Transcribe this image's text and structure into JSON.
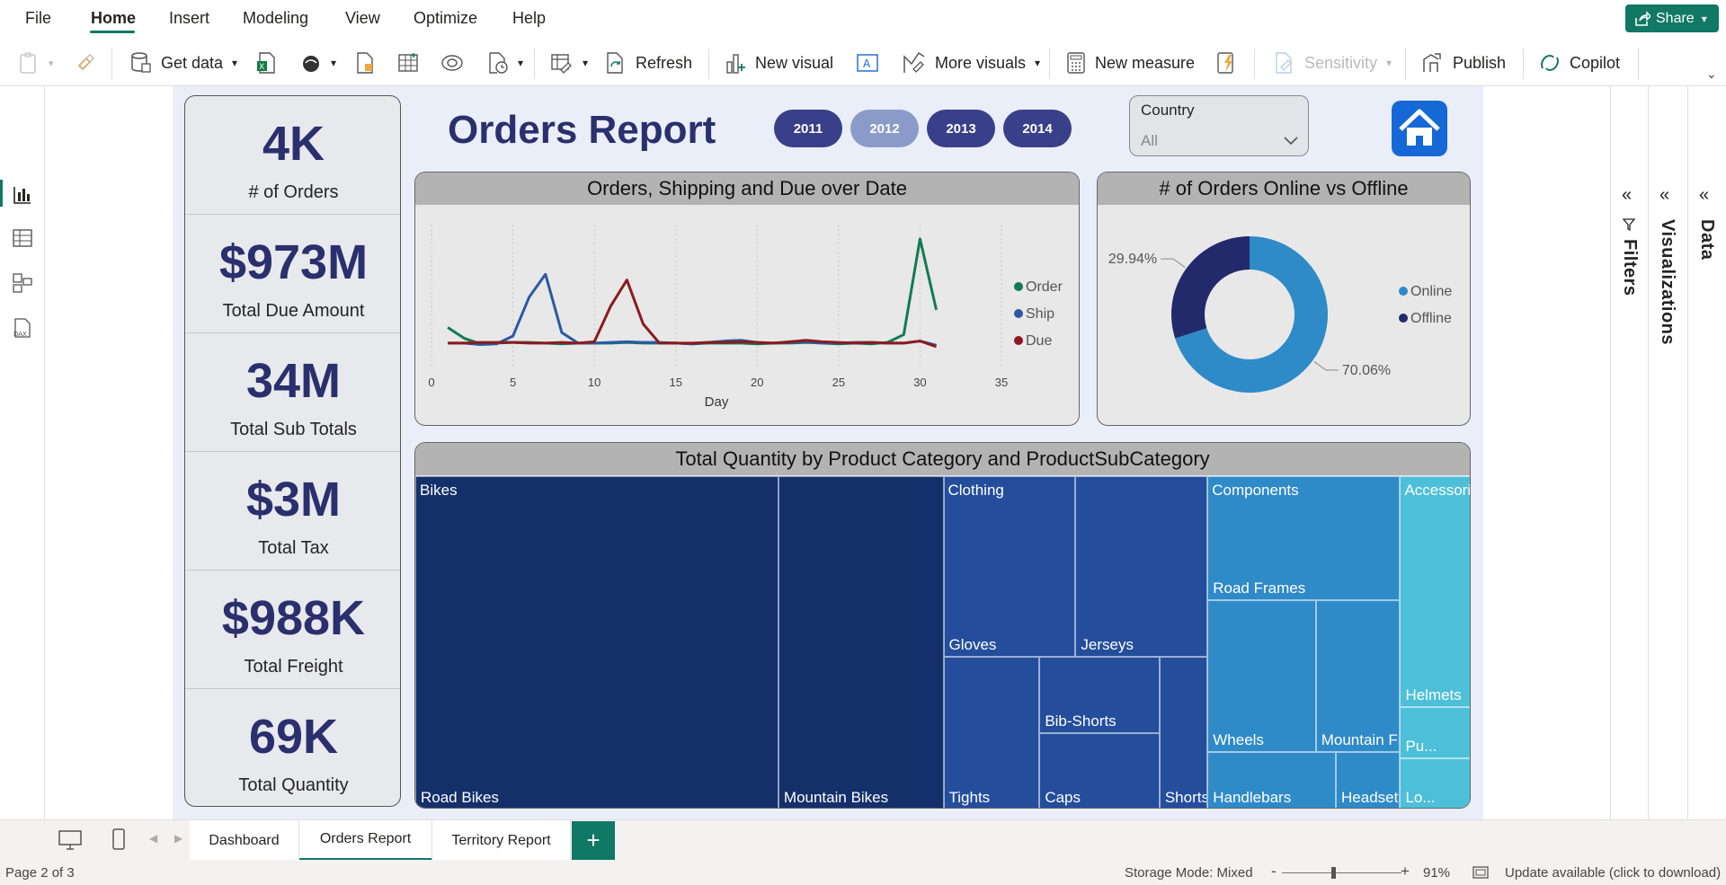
{
  "menu": {
    "items": [
      "File",
      "Home",
      "Insert",
      "Modeling",
      "View",
      "Optimize",
      "Help"
    ],
    "share": "Share"
  },
  "ribbon": {
    "get_data": "Get data",
    "refresh": "Refresh",
    "new_visual": "New visual",
    "more_visuals": "More visuals",
    "new_measure": "New measure",
    "sensitivity": "Sensitivity",
    "publish": "Publish",
    "copilot": "Copilot"
  },
  "panes": {
    "filters": "Filters",
    "visualizations": "Visualizations",
    "data": "Data"
  },
  "report": {
    "title": "Orders Report",
    "years": [
      "2011",
      "2012",
      "2013",
      "2014"
    ],
    "selected_year": "2012",
    "country": {
      "label": "Country",
      "value": "All"
    },
    "kpis": [
      {
        "value": "4K",
        "label": "# of Orders"
      },
      {
        "value": "$973M",
        "label": "Total Due Amount"
      },
      {
        "value": "34M",
        "label": "Total Sub Totals"
      },
      {
        "value": "$3M",
        "label": "Total Tax"
      },
      {
        "value": "$988K",
        "label": "Total Freight"
      },
      {
        "value": "69K",
        "label": "Total Quantity"
      }
    ]
  },
  "chart_data": [
    {
      "type": "line",
      "title": "Orders, Shipping and Due over Date",
      "xlabel": "Day",
      "xlim": [
        0,
        35
      ],
      "xticks": [
        0,
        5,
        10,
        15,
        20,
        25,
        30,
        35
      ],
      "grid": true,
      "legend": "right",
      "x": [
        1,
        2,
        3,
        4,
        5,
        6,
        7,
        8,
        9,
        10,
        11,
        12,
        13,
        14,
        15,
        16,
        17,
        18,
        19,
        20,
        21,
        22,
        23,
        24,
        25,
        26,
        27,
        28,
        29,
        30,
        31
      ],
      "series": [
        {
          "name": "Order",
          "color": "#137a55",
          "values": [
            55,
            40,
            32,
            33,
            34,
            34,
            33,
            32,
            33,
            33,
            33,
            34,
            33,
            33,
            33,
            32,
            33,
            33,
            33,
            32,
            33,
            33,
            34,
            33,
            32,
            33,
            32,
            34,
            45,
            180,
            80
          ]
        },
        {
          "name": "Ship",
          "color": "#2b59a3",
          "values": [
            33,
            33,
            31,
            32,
            43,
            98,
            130,
            48,
            33,
            33,
            34,
            35,
            34,
            34,
            33,
            32,
            34,
            36,
            37,
            34,
            33,
            34,
            35,
            33,
            33,
            34,
            34,
            33,
            33,
            36,
            30
          ]
        },
        {
          "name": "Due",
          "color": "#8c1a1f",
          "values": [
            33,
            33,
            34,
            34,
            34,
            33,
            33,
            34,
            33,
            35,
            85,
            122,
            60,
            33,
            33,
            33,
            34,
            34,
            35,
            34,
            33,
            35,
            37,
            35,
            34,
            33,
            34,
            33,
            33,
            36,
            28
          ]
        }
      ]
    },
    {
      "type": "pie",
      "title": "# of Orders Online vs Offline",
      "legend": "right",
      "slices": [
        {
          "name": "Online",
          "value": 70.06,
          "label": "70.06%",
          "color": "#2f8ac8"
        },
        {
          "name": "Offline",
          "value": 29.94,
          "label": "29.94%",
          "color": "#222a6b"
        }
      ]
    },
    {
      "type": "treemap",
      "title": "Total Quantity by Product Category and ProductSubCategory",
      "categories": [
        {
          "name": "Bikes",
          "color": "#14306a",
          "children": [
            {
              "name": "Road Bikes",
              "value": 66
            },
            {
              "name": "Mountain Bikes",
              "value": 30
            }
          ]
        },
        {
          "name": "Clothing",
          "color": "#244e9c",
          "children": [
            {
              "name": "Gloves",
              "value": 13
            },
            {
              "name": "Jerseys",
              "value": 13
            },
            {
              "name": "Tights",
              "value": 8
            },
            {
              "name": "Bib-Shorts",
              "value": 5
            },
            {
              "name": "Caps",
              "value": 5
            },
            {
              "name": "Shorts",
              "value": 4
            }
          ]
        },
        {
          "name": "Components",
          "color": "#2f8ac8",
          "children": [
            {
              "name": "Road Frames",
              "value": 13
            },
            {
              "name": "Wheels",
              "value": 9
            },
            {
              "name": "Mountain Fra...",
              "value": 7
            },
            {
              "name": "Handlebars",
              "value": 4
            },
            {
              "name": "Headsets",
              "value": 2
            }
          ]
        },
        {
          "name": "Accessories",
          "color": "#4dbfd9",
          "children": [
            {
              "name": "Helmets",
              "value": 9
            },
            {
              "name": "Pu...",
              "value": 2
            },
            {
              "name": "Lo...",
              "value": 2
            }
          ]
        }
      ]
    }
  ],
  "tabs": {
    "items": [
      "Dashboard",
      "Orders Report",
      "Territory Report"
    ],
    "active": "Orders Report",
    "add": "+"
  },
  "status": {
    "page": "Page 2 of 3",
    "storage": "Storage Mode: Mixed",
    "zoom": "91%",
    "zoom_minus": "-",
    "zoom_plus": "+",
    "update": "Update available (click to download)"
  }
}
